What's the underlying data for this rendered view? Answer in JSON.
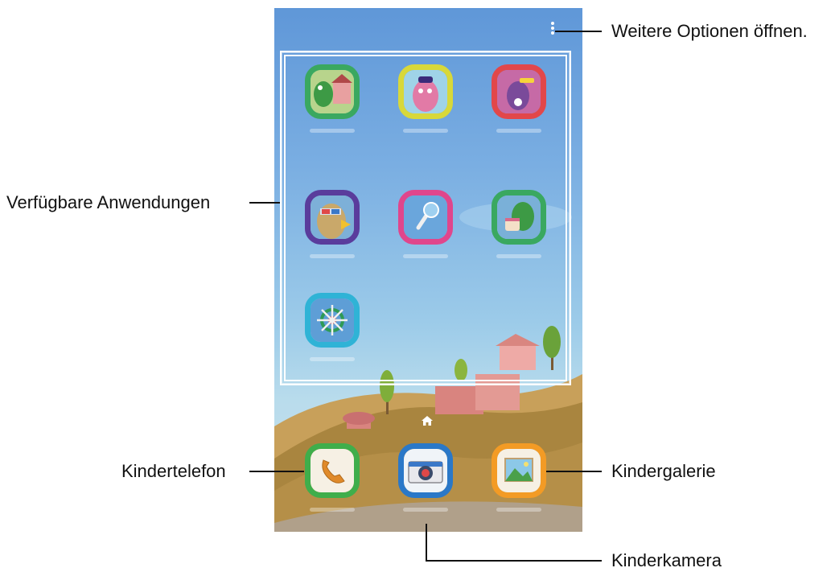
{
  "callouts": {
    "more_options": "Weitere Optionen öffnen.",
    "available_apps": "Verfügbare Anwendungen",
    "kids_phone": "Kindertelefon",
    "kids_gallery": "Kindergalerie",
    "kids_camera": "Kinderkamera"
  },
  "screen": {
    "menu_icon": "more-vertical-icon",
    "apps": [
      {
        "icon": "dinosaur-house-icon",
        "frame": "#3aa860"
      },
      {
        "icon": "pink-creature-paint-icon",
        "frame": "#d8d83a"
      },
      {
        "icon": "dinosaur-sunglasses-icon",
        "frame": "#e2474a"
      },
      {
        "icon": "monster-3d-glasses-icon",
        "frame": "#5a3c9c"
      },
      {
        "icon": "microphone-icon",
        "frame": "#e0468c"
      },
      {
        "icon": "dinosaur-cake-icon",
        "frame": "#3aa860"
      },
      {
        "icon": "ship-wheel-icon",
        "frame": "#2fb3d6"
      }
    ],
    "dock": [
      {
        "icon": "phone-icon",
        "frame": "#3fae4b"
      },
      {
        "icon": "camera-icon",
        "frame": "#2a78c8"
      },
      {
        "icon": "gallery-icon",
        "frame": "#f39b25"
      }
    ],
    "home_icon": "home-icon"
  }
}
